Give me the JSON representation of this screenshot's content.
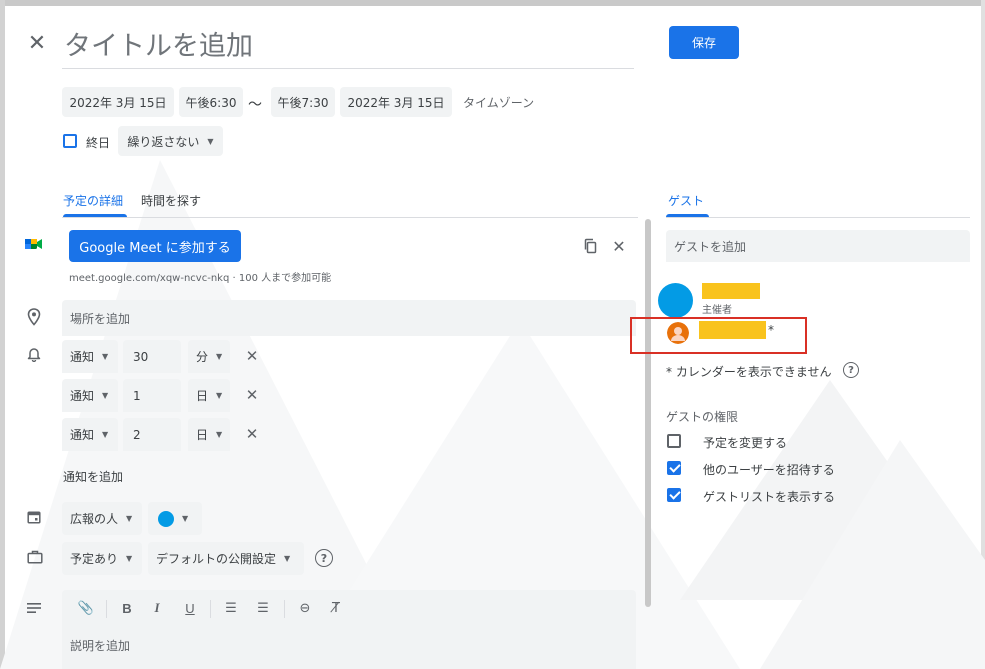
{
  "event": {
    "title_placeholder": "タイトルを追加",
    "save_label": "保存",
    "start_date": "2022年 3月 15日",
    "start_time": "午後6:30",
    "time_separator": "～",
    "end_time": "午後7:30",
    "end_date": "2022年 3月 15日",
    "timezone_label": "タイムゾーン",
    "all_day_label": "終日",
    "repeat_value": "繰り返さない"
  },
  "tabs": [
    {
      "label": "予定の詳細",
      "active": true
    },
    {
      "label": "時間を探す",
      "active": false
    }
  ],
  "meet": {
    "button_label": "Google Meet に参加する",
    "link_text": "meet.google.com/xqw-ncvc-nkq · 100 人まで参加可能"
  },
  "location_placeholder": "場所を追加",
  "notifications": [
    {
      "type": "通知",
      "value": "30",
      "unit": "分"
    },
    {
      "type": "通知",
      "value": "1",
      "unit": "日"
    },
    {
      "type": "通知",
      "value": "2",
      "unit": "日"
    }
  ],
  "add_notification_label": "通知を追加",
  "calendar": {
    "name": "広報の人",
    "color": "#039be5"
  },
  "availability": {
    "status": "予定あり",
    "visibility": "デフォルトの公開設定"
  },
  "description_placeholder": "説明を追加",
  "guests_panel": {
    "tab_label": "ゲスト",
    "add_guest_placeholder": "ゲストを追加",
    "organizer_role": "主催者",
    "guest_suffix": "*",
    "calendar_unavailable_note": "* カレンダーを表示できません",
    "permissions_heading": "ゲストの権限",
    "permissions": [
      {
        "label": "予定を変更する",
        "checked": false
      },
      {
        "label": "他のユーザーを招待する",
        "checked": true
      },
      {
        "label": "ゲストリストを表示する",
        "checked": true
      }
    ]
  },
  "colors": {
    "accent": "#1a73e8",
    "redacted": "#f9c31d",
    "organizer_avatar": "#039be5",
    "guest_avatar": "#e8710a",
    "highlight": "#d93025"
  }
}
